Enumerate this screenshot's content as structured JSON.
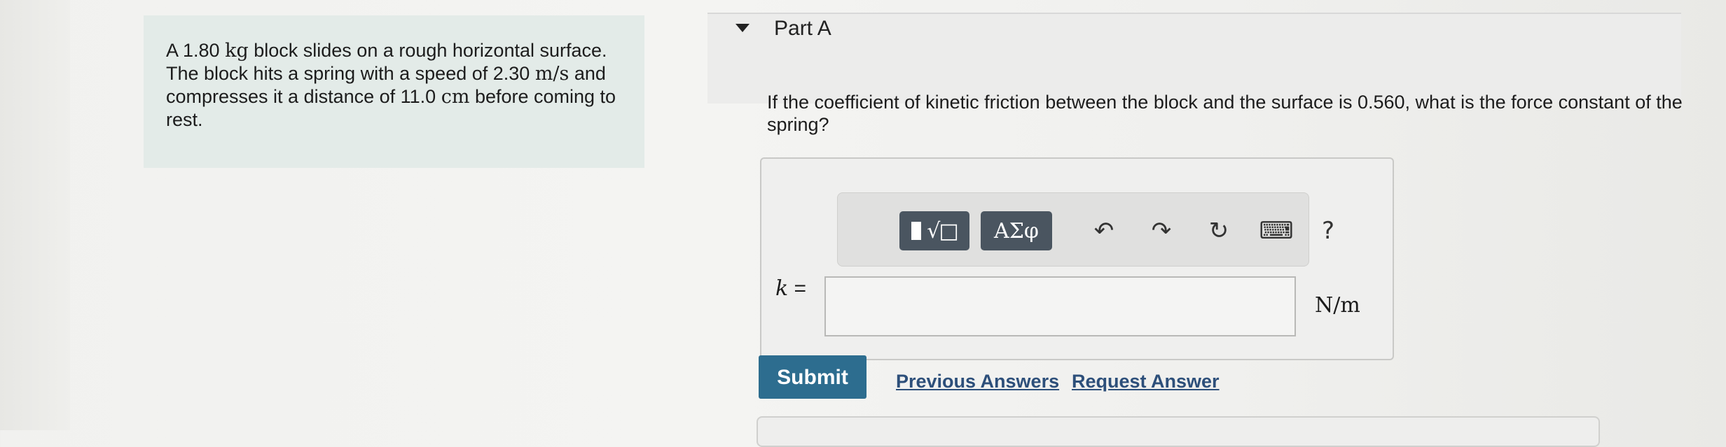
{
  "problem": {
    "text_1": "A 1.80 ",
    "mass_unit": "kg",
    "text_2": " block slides on a rough horizontal surface. The block hits a spring with a speed of 2.30 ",
    "speed_unit": "m/s",
    "text_3": " and compresses it a distance of 11.0 ",
    "distance_unit": "cm",
    "text_4": " before coming to rest."
  },
  "part": {
    "title": "Part A",
    "question": "If the coefficient of kinetic friction between the block and the surface is 0.560, what is the force constant of the spring?"
  },
  "toolbar": {
    "template_symbol": "√□",
    "greek_label": "ΑΣφ",
    "undo_glyph": "↶",
    "redo_glyph": "↷",
    "reset_glyph": "↻",
    "keyboard_glyph": "⌨",
    "help_label": "?"
  },
  "answer": {
    "variable": "k",
    "equals": " =",
    "value": "",
    "unit": "N/m"
  },
  "actions": {
    "submit_label": "Submit",
    "previous_answers_label": "Previous Answers",
    "request_answer_label": "Request Answer"
  },
  "colors": {
    "accent": "#2d6d8f",
    "toolbar_button": "#4a5560",
    "problem_bg": "#e3ebe8",
    "link": "#2d4f7a"
  }
}
